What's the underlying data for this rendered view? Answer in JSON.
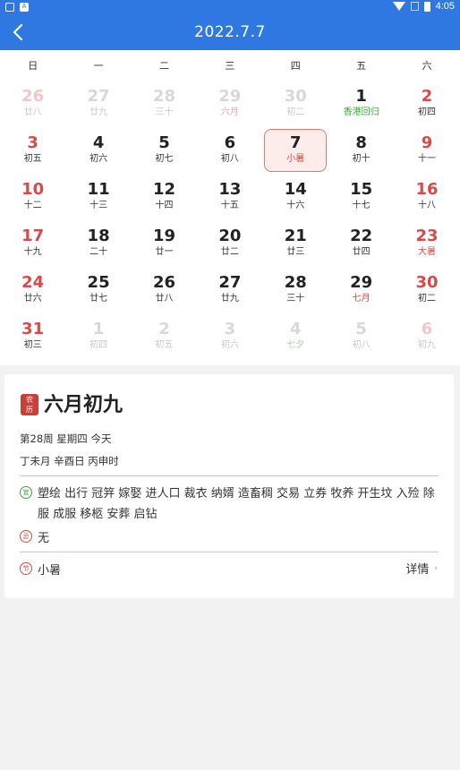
{
  "status_bar": {
    "left_badge": "A",
    "time": "4:05"
  },
  "header": {
    "title": "2022.7.7"
  },
  "calendar": {
    "weekdays": [
      "日",
      "一",
      "二",
      "三",
      "四",
      "五",
      "六"
    ],
    "days": [
      {
        "num": "26",
        "sub": "廿八",
        "other": true,
        "weekend": true
      },
      {
        "num": "27",
        "sub": "廿九",
        "other": true
      },
      {
        "num": "28",
        "sub": "三十",
        "other": true
      },
      {
        "num": "29",
        "sub": "六月",
        "other": true,
        "sub_style": "soft-red"
      },
      {
        "num": "30",
        "sub": "初二",
        "other": true
      },
      {
        "num": "1",
        "sub": "香港回归",
        "sub_style": "festival"
      },
      {
        "num": "2",
        "sub": "初四",
        "weekend": true
      },
      {
        "num": "3",
        "sub": "初五",
        "weekend": true
      },
      {
        "num": "4",
        "sub": "初六"
      },
      {
        "num": "5",
        "sub": "初七"
      },
      {
        "num": "6",
        "sub": "初八"
      },
      {
        "num": "7",
        "sub": "小暑",
        "selected": true
      },
      {
        "num": "8",
        "sub": "初十"
      },
      {
        "num": "9",
        "sub": "十一",
        "weekend": true
      },
      {
        "num": "10",
        "sub": "十二",
        "weekend": true
      },
      {
        "num": "11",
        "sub": "十三"
      },
      {
        "num": "12",
        "sub": "十四"
      },
      {
        "num": "13",
        "sub": "十五"
      },
      {
        "num": "14",
        "sub": "十六"
      },
      {
        "num": "15",
        "sub": "十七"
      },
      {
        "num": "16",
        "sub": "十八",
        "weekend": true
      },
      {
        "num": "17",
        "sub": "十九",
        "weekend": true
      },
      {
        "num": "18",
        "sub": "二十"
      },
      {
        "num": "19",
        "sub": "廿一"
      },
      {
        "num": "20",
        "sub": "廿二"
      },
      {
        "num": "21",
        "sub": "廿三"
      },
      {
        "num": "22",
        "sub": "廿四"
      },
      {
        "num": "23",
        "sub": "大暑",
        "weekend": true,
        "sub_style": "red"
      },
      {
        "num": "24",
        "sub": "廿六",
        "weekend": true
      },
      {
        "num": "25",
        "sub": "廿七"
      },
      {
        "num": "26",
        "sub": "廿八"
      },
      {
        "num": "27",
        "sub": "廿九"
      },
      {
        "num": "28",
        "sub": "三十"
      },
      {
        "num": "29",
        "sub": "七月",
        "sub_style": "red"
      },
      {
        "num": "30",
        "sub": "初二",
        "weekend": true
      },
      {
        "num": "31",
        "sub": "初三",
        "weekend": true
      },
      {
        "num": "1",
        "sub": "初四",
        "other": true
      },
      {
        "num": "2",
        "sub": "初五",
        "other": true
      },
      {
        "num": "3",
        "sub": "初六",
        "other": true
      },
      {
        "num": "4",
        "sub": "七夕",
        "other": true,
        "sub_style": "soft-green"
      },
      {
        "num": "5",
        "sub": "初八",
        "other": true
      },
      {
        "num": "6",
        "sub": "初九",
        "other": true,
        "weekend": true
      }
    ]
  },
  "detail": {
    "badge_line1": "农",
    "badge_line2": "历",
    "lunar_date": "六月初九",
    "week_info": "第28周 星期四 今天",
    "ganzhi": "丁未月 辛酉日 丙申时",
    "yi_icon": "宜",
    "yi": "塑绘 出行 冠笄 嫁娶 进人口 裁衣 纳婿 造畜稠 交易 立券 牧养 开生坟 入殓 除服 成服 移柩 安葬 启钻",
    "ji_icon": "忌",
    "ji": "无",
    "jie_icon": "节",
    "jieqi": "小暑",
    "more_label": "详情"
  },
  "colors": {
    "primary": "#2f78e2",
    "weekend": "#d84a4a",
    "festival": "#3ea53e"
  }
}
